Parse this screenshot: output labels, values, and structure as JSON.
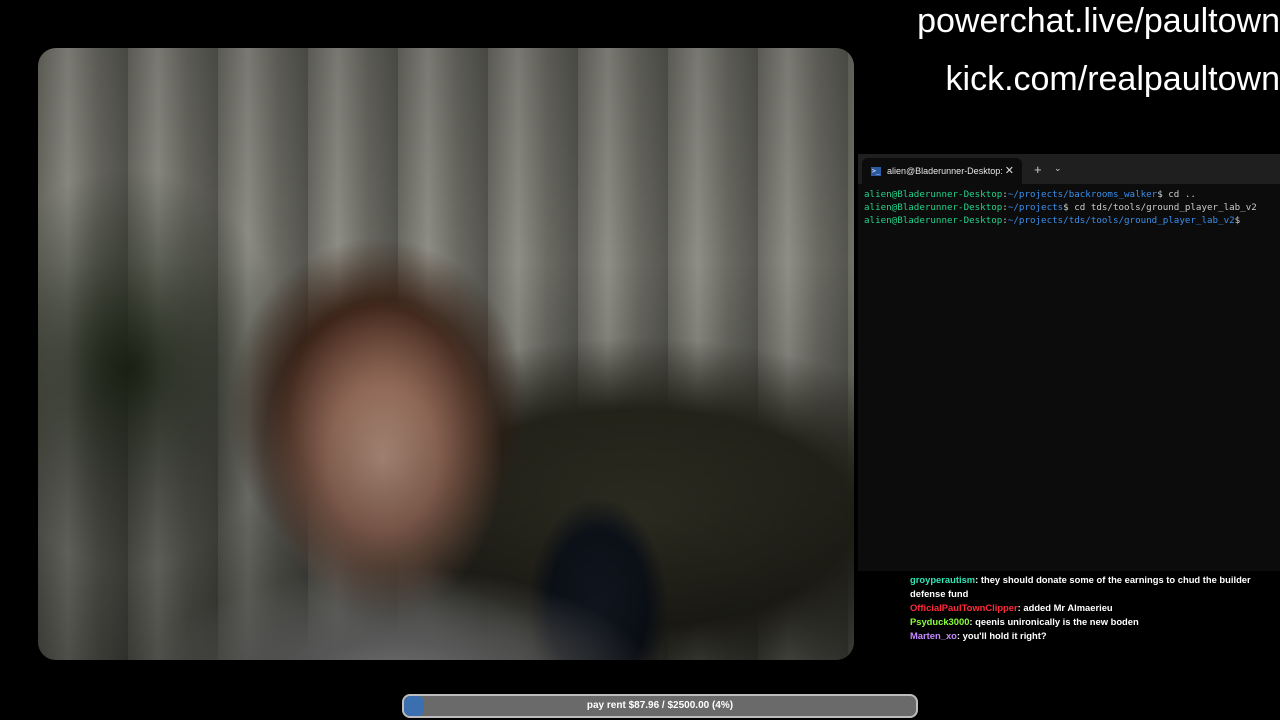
{
  "overlay": {
    "link1": "powerchat.live/paultown",
    "link2": "kick.com/realpaultown"
  },
  "terminal": {
    "tab_title": "alien@Bladerunner-Desktop:",
    "tab_close": "✕",
    "tab_add": "+",
    "tab_dropdown": "⌄",
    "lines": [
      {
        "user": "alien@Bladerunner-Desktop",
        "sep": ":",
        "path": "~/projects/backrooms_walker",
        "cmd": "$ cd .."
      },
      {
        "user": "alien@Bladerunner-Desktop",
        "sep": ":",
        "path": "~/projects",
        "cmd": "$ cd tds/tools/ground_player_lab_v2"
      },
      {
        "user": "alien@Bladerunner-Desktop",
        "sep": ":",
        "path": "~/projects/tds/tools/ground_player_lab_v2",
        "cmd": "$"
      }
    ],
    "colors": {
      "user": "#23d18b",
      "path": "#3b8eea"
    }
  },
  "chat": {
    "messages": [
      {
        "user": "groyperautism",
        "color": "#2ee6b6",
        "text": "they should donate some of the earnings to chud the builder defense fund"
      },
      {
        "user": "OfficialPaulTownClipper",
        "color": "#ff2a3a",
        "text": "added Mr Almaerieu"
      },
      {
        "user": "Psyduck3000",
        "color": "#8aff3a",
        "text": "qeenis unironically is the new boden"
      },
      {
        "user": "Marten_xo",
        "color": "#c58aff",
        "text": "you'll hold it right?"
      }
    ]
  },
  "goal": {
    "label": "pay rent $87.96 / $2500.00 (4%)",
    "progress": 0.04,
    "color": "#3b6fb0"
  }
}
